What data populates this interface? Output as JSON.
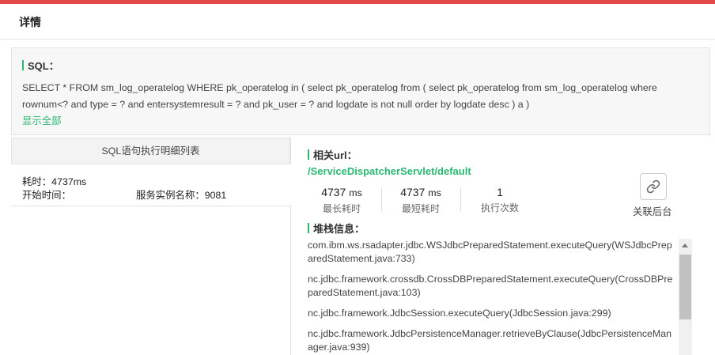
{
  "header": {
    "title": "详情"
  },
  "sql": {
    "title": "SQL：",
    "text": "SELECT * FROM sm_log_operatelog WHERE pk_operatelog in ( select pk_operatelog from ( select pk_operatelog from sm_log_operatelog where rownum<? and type = ? and entersystemresult = ? and pk_user = ? and logdate is not null order by logdate desc ) a )",
    "show_all": "显示全部"
  },
  "left": {
    "header": "SQL语句执行明细列表",
    "row": {
      "duration": "耗时：4737ms",
      "start_time": "开始时间：",
      "service_instance": "服务实例名称：9081"
    }
  },
  "right": {
    "url_title": "相关url：",
    "url": "/ServiceDispatcherServlet/default",
    "stats": [
      {
        "value": "4737",
        "unit": "ms",
        "label": "最长耗时"
      },
      {
        "value": "4737",
        "unit": "ms",
        "label": "最短耗时"
      },
      {
        "value": "1",
        "unit": "",
        "label": "执行次数"
      }
    ],
    "link_label": "关联后台",
    "stack_title": "堆栈信息：",
    "stack": [
      "com.ibm.ws.rsadapter.jdbc.WSJdbcPreparedStatement.executeQuery(WSJdbcPreparedStatement.java:733)",
      "nc.jdbc.framework.crossdb.CrossDBPreparedStatement.executeQuery(CrossDBPreparedStatement.java:103)",
      "nc.jdbc.framework.JdbcSession.executeQuery(JdbcSession.java:299)",
      "nc.jdbc.framework.JdbcPersistenceManager.retrieveByClause(JdbcPersistenceManager.java:939)"
    ]
  },
  "colors": {
    "accent": "#2bb673",
    "top_bar": "#e24a47"
  }
}
